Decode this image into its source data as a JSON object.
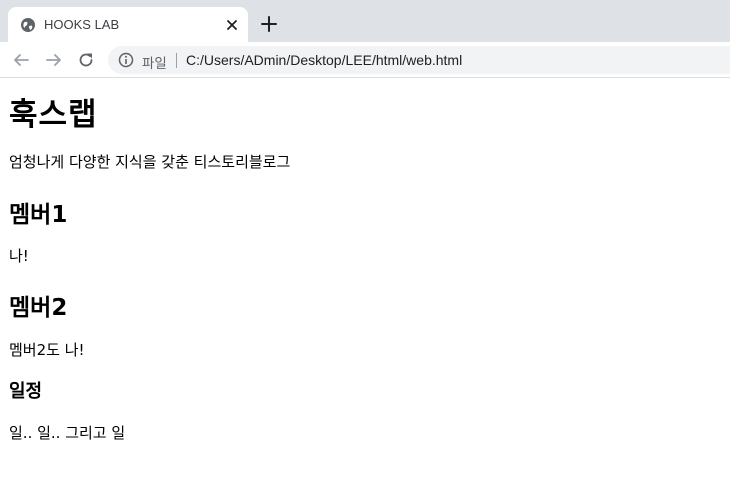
{
  "browser": {
    "tab_title": "HOOKS LAB",
    "scheme_label": "파일",
    "url": "C:/Users/ADmin/Desktop/LEE/html/web.html"
  },
  "page": {
    "heading1": "훅스랩",
    "intro": "엄청나게 다양한 지식을 갖춘 티스토리블로그",
    "member1": {
      "heading": "멤버1",
      "text": "나!"
    },
    "member2": {
      "heading": "멤버2",
      "text": "멤버2도 나!"
    },
    "schedule": {
      "heading": "일정",
      "text": "일.. 일.. 그리고 일"
    }
  }
}
